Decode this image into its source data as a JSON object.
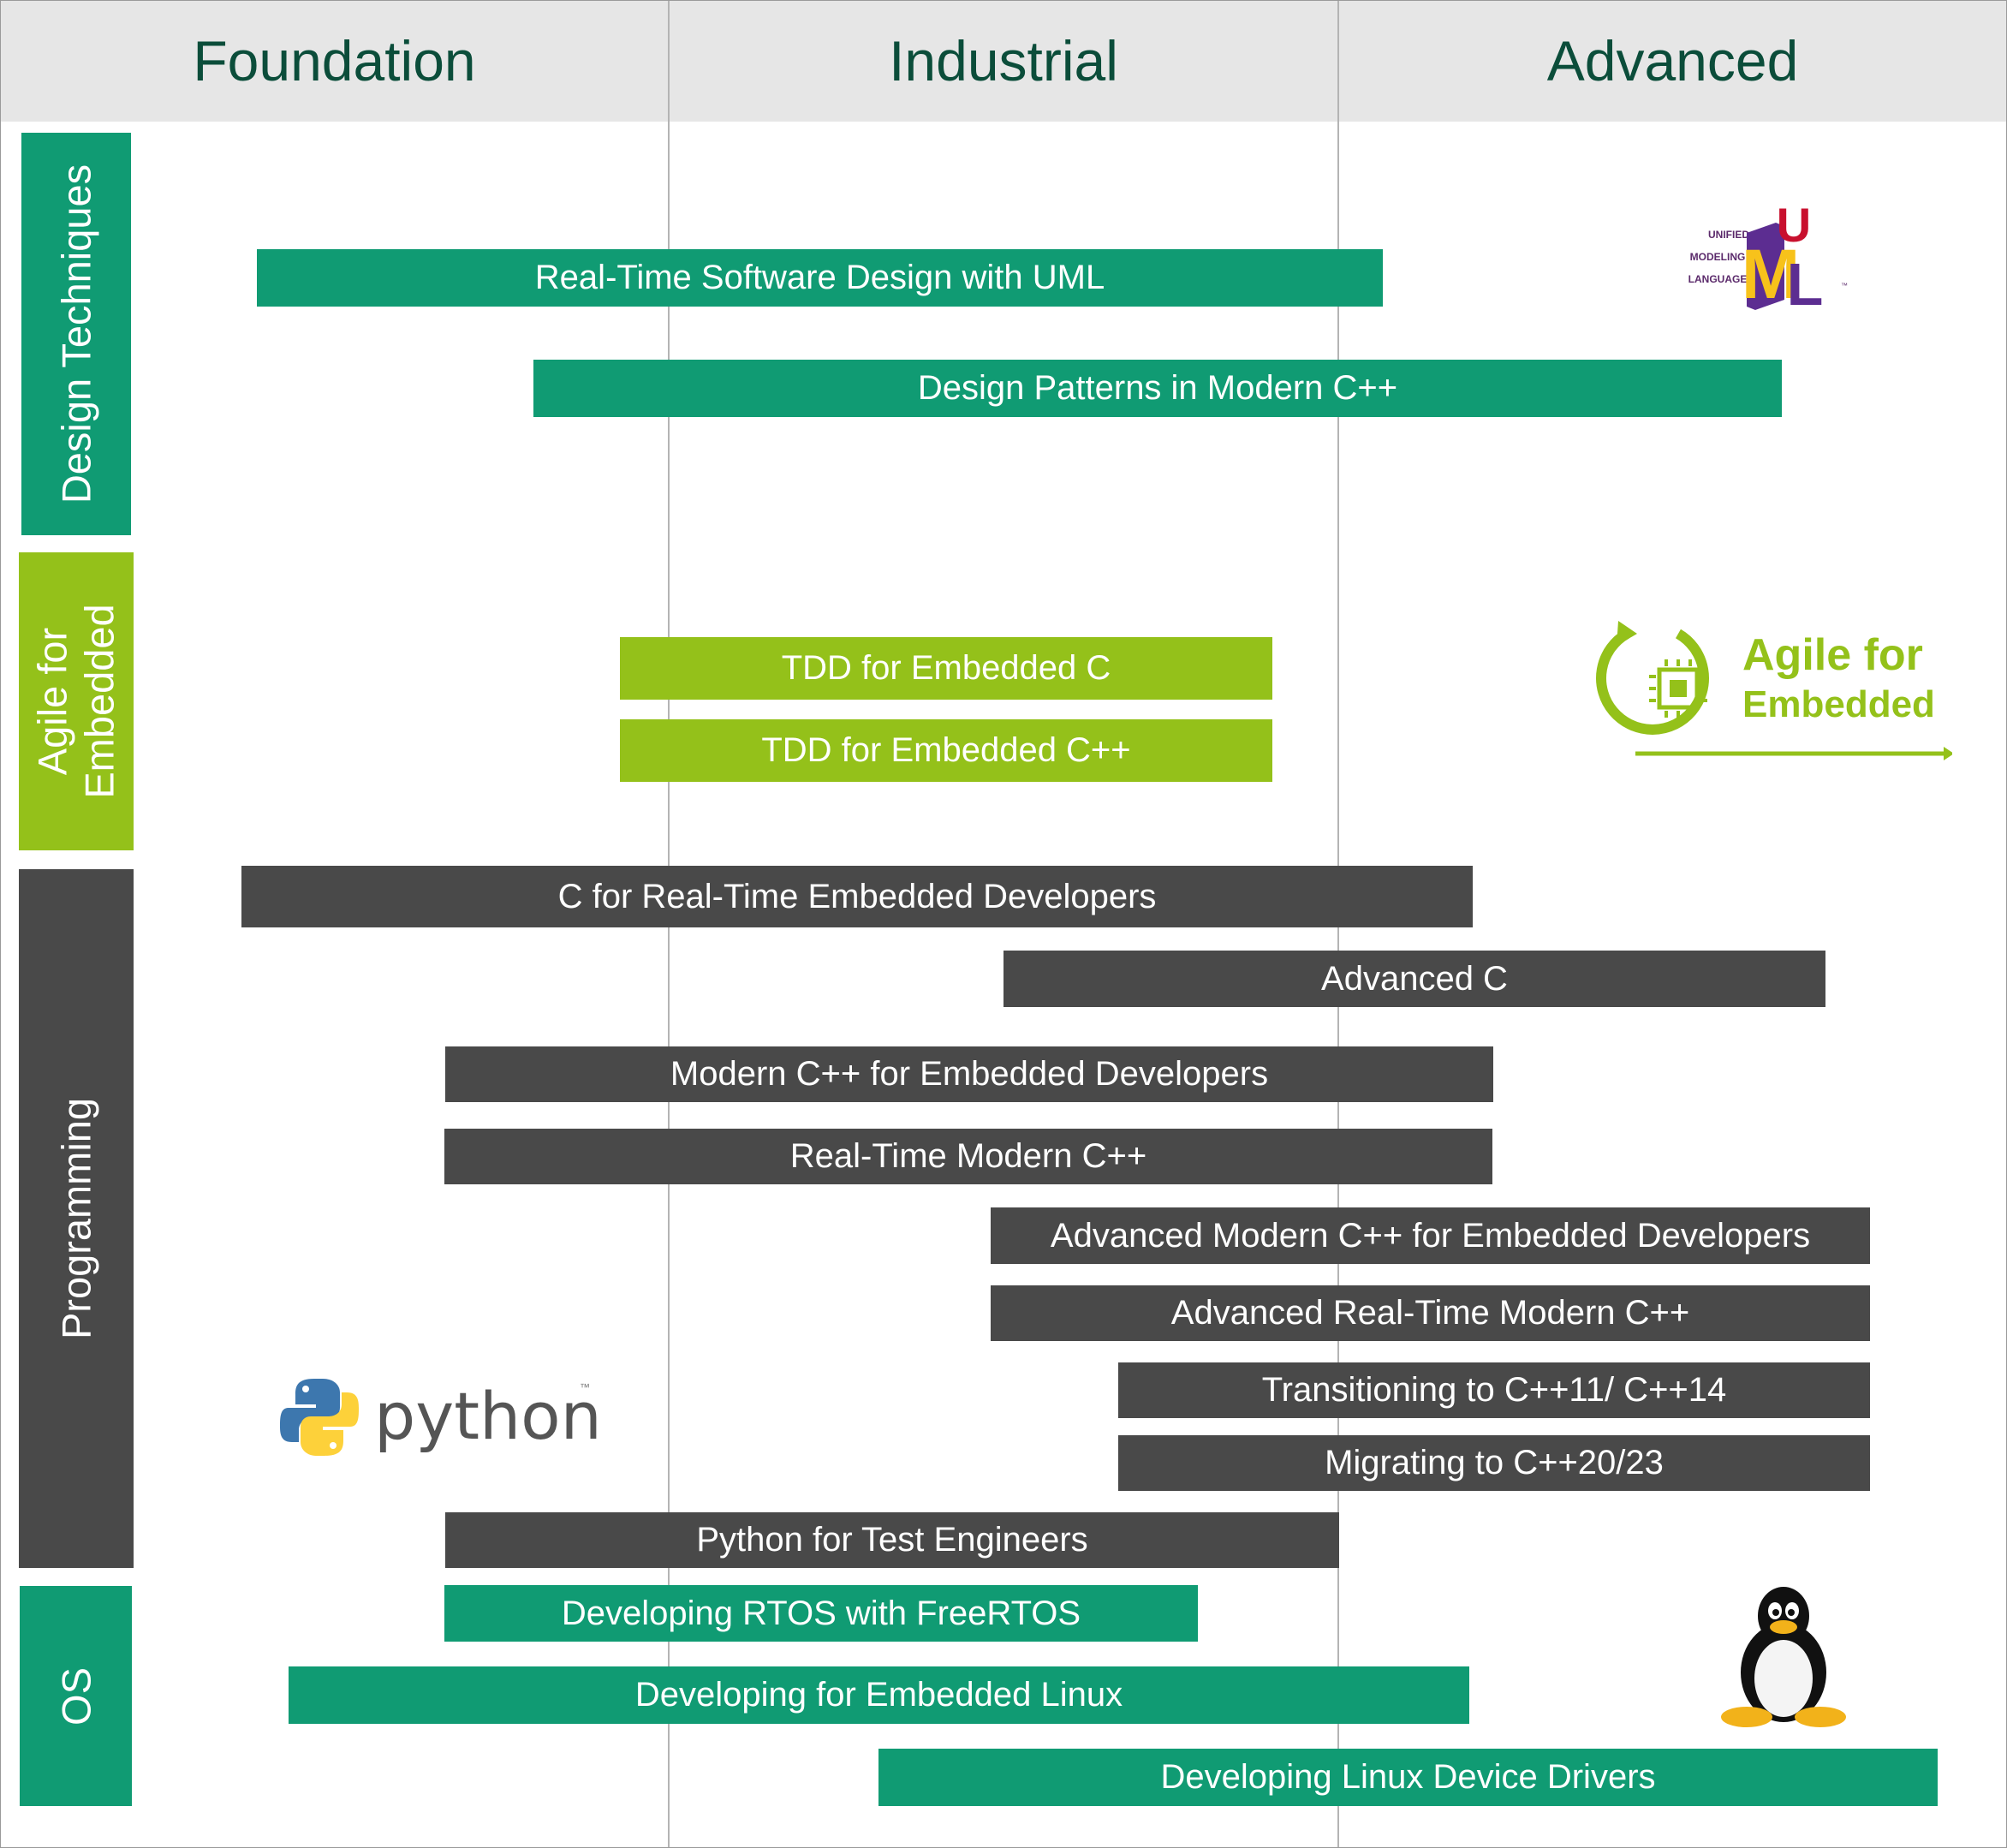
{
  "columns": [
    "Foundation",
    "Industrial",
    "Advanced"
  ],
  "categories": {
    "design": "Design Techniques",
    "agile_line1": "Agile for",
    "agile_line2": "Embedded",
    "programming": "Programming",
    "os": "OS"
  },
  "courses": {
    "uml": "Real-Time Software Design with UML",
    "patterns": "Design Patterns in Modern C++",
    "tdd_c": "TDD for Embedded C",
    "tdd_cpp": "TDD for Embedded C++",
    "c_rt": "C for Real-Time Embedded Developers",
    "adv_c": "Advanced C",
    "modern_cpp": "Modern C++ for Embedded Developers",
    "rt_modern_cpp": "Real-Time Modern C++",
    "adv_modern_cpp": "Advanced Modern C++ for Embedded Developers",
    "adv_rt_modern_cpp": "Advanced Real-Time Modern C++",
    "cpp11": "Transitioning to C++11/ C++14",
    "cpp20": "Migrating to C++20/23",
    "python": "Python for Test Engineers",
    "freertos": "Developing RTOS with FreeRTOS",
    "emb_linux": "Developing for Embedded Linux",
    "linux_drivers": "Developing Linux Device Drivers"
  },
  "logos": {
    "uml_line1": "UNIFIED",
    "uml_line2": "MODELING",
    "uml_line3": "LANGUAGE",
    "uml_u": "U",
    "uml_m": "M",
    "uml_l": "L",
    "uml_tm": "™",
    "agile_line1": "Agile for",
    "agile_line2": "Embedded",
    "python_word": "python",
    "python_tm": "™"
  },
  "colors": {
    "teal": "#109b73",
    "green": "#94c11a",
    "dark": "#494949",
    "header_bg": "#e6e6e6",
    "header_text": "#0b4d3a"
  }
}
